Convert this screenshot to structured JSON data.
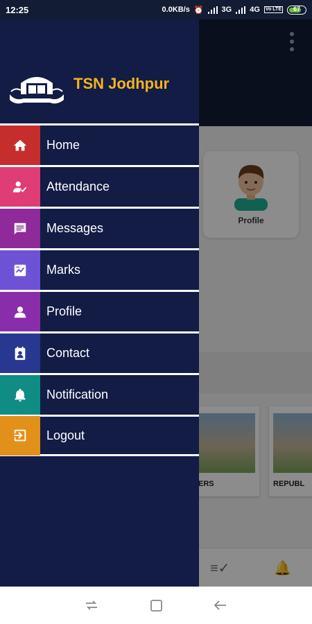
{
  "status": {
    "time": "12:25",
    "speed": "0.0KB/s",
    "net1": "3G",
    "net2": "4G",
    "volte": "Vo LTE",
    "battery": "67"
  },
  "drawer": {
    "school_name": "TSN Jodhpur",
    "items": [
      {
        "label": "Home",
        "icon": "home-icon",
        "color": "#c62d2d"
      },
      {
        "label": "Attendance",
        "icon": "attendance-icon",
        "color": "#e03c76"
      },
      {
        "label": "Messages",
        "icon": "message-icon",
        "color": "#8e2a9a"
      },
      {
        "label": "Marks",
        "icon": "marks-icon",
        "color": "#6e52d6"
      },
      {
        "label": "Profile",
        "icon": "profile-icon",
        "color": "#8a2daa"
      },
      {
        "label": "Contact",
        "icon": "contact-icon",
        "color": "#28378f"
      },
      {
        "label": "Notification",
        "icon": "bell-icon",
        "color": "#0f8c84"
      },
      {
        "label": "Logout",
        "icon": "logout-icon",
        "color": "#e3901b"
      }
    ]
  },
  "background": {
    "profile_card_label": "Profile",
    "gallery": [
      {
        "caption": "ERS"
      },
      {
        "caption": "REPUBL"
      }
    ]
  }
}
